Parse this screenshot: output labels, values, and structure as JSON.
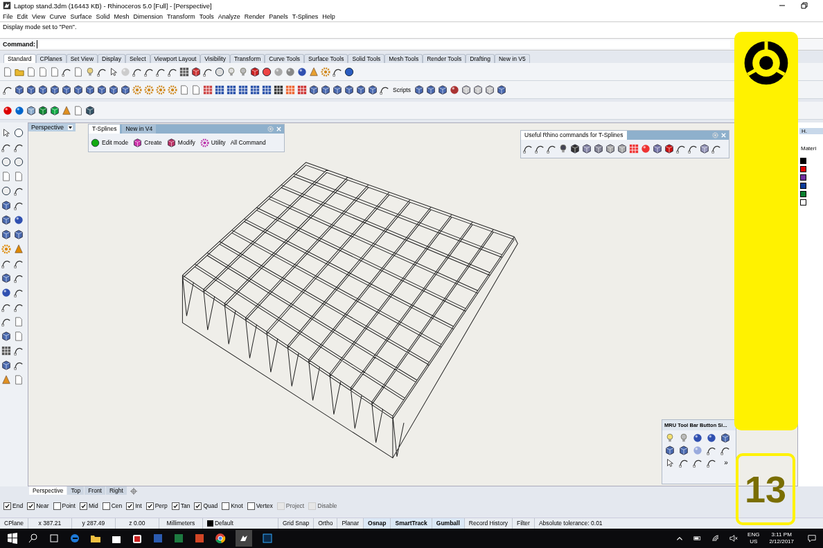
{
  "window": {
    "title": "Laptop stand.3dm (16443 KB) - Rhinoceros 5.0 [Full] - [Perspective]"
  },
  "menu": [
    "File",
    "Edit",
    "View",
    "Curve",
    "Surface",
    "Solid",
    "Mesh",
    "Dimension",
    "Transform",
    "Tools",
    "Analyze",
    "Render",
    "Panels",
    "T-Splines",
    "Help"
  ],
  "command_history": "Display mode set to \"Pen\".",
  "command": {
    "label": "Command:"
  },
  "toolbar_tabs": [
    {
      "label": "Standard",
      "selected": true
    },
    {
      "label": "CPlanes",
      "selected": false
    },
    {
      "label": "Set View",
      "selected": false
    },
    {
      "label": "Display",
      "selected": false
    },
    {
      "label": "Select",
      "selected": false
    },
    {
      "label": "Viewport Layout",
      "selected": false
    },
    {
      "label": "Visibility",
      "selected": false
    },
    {
      "label": "Transform",
      "selected": false
    },
    {
      "label": "Curve Tools",
      "selected": false
    },
    {
      "label": "Surface Tools",
      "selected": false
    },
    {
      "label": "Solid Tools",
      "selected": false
    },
    {
      "label": "Mesh Tools",
      "selected": false
    },
    {
      "label": "Render Tools",
      "selected": false
    },
    {
      "label": "Drafting",
      "selected": false
    },
    {
      "label": "New in V5",
      "selected": false
    }
  ],
  "scripts_button": "Scripts",
  "viewport": {
    "label": "Perspective"
  },
  "tsplines_toolbar": {
    "tabs": [
      {
        "label": "T-Splines",
        "selected": true
      },
      {
        "label": "New in V4",
        "selected": false
      }
    ],
    "buttons": [
      "Edit mode",
      "Create",
      "Modify",
      "Utility",
      "All Command"
    ]
  },
  "useful_toolbar": {
    "title": "Useful Rhino commands for T-Splines"
  },
  "mru_toolbar": {
    "title": "MRU Tool Bar Button Si...",
    "more": "»"
  },
  "right_panel": {
    "tab": "H.",
    "column": "Materi",
    "layers": [
      {
        "color": "#000000"
      },
      {
        "color": "#e00000"
      },
      {
        "color": "#7030a0"
      },
      {
        "color": "#0a3c9a"
      },
      {
        "color": "#0a8030"
      },
      {
        "color": "#ffffff"
      }
    ]
  },
  "overlay": {
    "number": "13"
  },
  "viewport_tabs": [
    {
      "label": "Perspective",
      "selected": true
    },
    {
      "label": "Top",
      "selected": false
    },
    {
      "label": "Front",
      "selected": false
    },
    {
      "label": "Right",
      "selected": false
    }
  ],
  "osnaps": [
    {
      "label": "End",
      "checked": true,
      "disabled": false
    },
    {
      "label": "Near",
      "checked": true,
      "disabled": false
    },
    {
      "label": "Point",
      "checked": false,
      "disabled": false
    },
    {
      "label": "Mid",
      "checked": true,
      "disabled": false
    },
    {
      "label": "Cen",
      "checked": false,
      "disabled": false
    },
    {
      "label": "Int",
      "checked": true,
      "disabled": false
    },
    {
      "label": "Perp",
      "checked": true,
      "disabled": false
    },
    {
      "label": "Tan",
      "checked": true,
      "disabled": false
    },
    {
      "label": "Quad",
      "checked": true,
      "disabled": false
    },
    {
      "label": "Knot",
      "checked": false,
      "disabled": false
    },
    {
      "label": "Vertex",
      "checked": false,
      "disabled": false
    },
    {
      "label": "Project",
      "checked": false,
      "disabled": true
    },
    {
      "label": "Disable",
      "checked": false,
      "disabled": true
    }
  ],
  "status_bar": {
    "cplane": "CPlane",
    "x": "x 387.21",
    "y": "y 287.49",
    "z": "z 0.00",
    "units": "Millimeters",
    "layer": {
      "name": "Default",
      "color": "#000000"
    },
    "toggles": [
      {
        "label": "Grid Snap",
        "on": false
      },
      {
        "label": "Ortho",
        "on": false
      },
      {
        "label": "Planar",
        "on": false
      },
      {
        "label": "Osnap",
        "on": true
      },
      {
        "label": "SmartTrack",
        "on": true
      },
      {
        "label": "Gumball",
        "on": true
      },
      {
        "label": "Record History",
        "on": false
      },
      {
        "label": "Filter",
        "on": false
      }
    ],
    "tolerance": "Absolute tolerance: 0.01"
  },
  "taskbar": {
    "language": "ENG",
    "region": "US",
    "time": "3:11 PM",
    "date": "2/12/2017"
  }
}
